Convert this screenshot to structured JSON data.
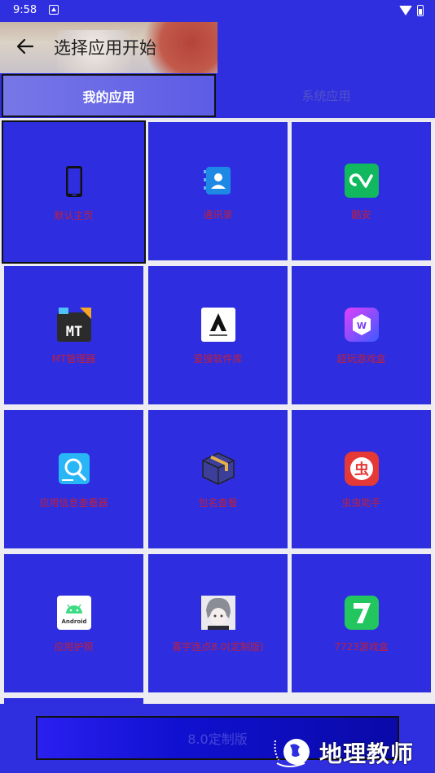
{
  "status_bar": {
    "time": "9:58"
  },
  "header": {
    "title": "选择应用开始"
  },
  "tabs": [
    {
      "label": "我的应用"
    },
    {
      "label": "系统应用"
    }
  ],
  "apps": [
    {
      "label": "默认主页",
      "icon": "phone-icon"
    },
    {
      "label": "通讯录",
      "icon": "contacts-icon"
    },
    {
      "label": "酷安",
      "icon": "coolapk-icon"
    },
    {
      "label": "MT管理器",
      "icon": "mt-manager-icon"
    },
    {
      "label": "爱搜软件库",
      "icon": "aisou-icon"
    },
    {
      "label": "超玩游戏盒",
      "icon": "game-box-icon"
    },
    {
      "label": "应用信息查看器",
      "icon": "app-info-icon"
    },
    {
      "label": "包名查看",
      "icon": "package-icon"
    },
    {
      "label": "虫虫助手",
      "icon": "chongchong-icon"
    },
    {
      "label": "应用护照",
      "icon": "android-icon"
    },
    {
      "label": "喜宇连点8.0(定制版)",
      "icon": "avatar-icon"
    },
    {
      "label": "7723游戏盒",
      "icon": "7723-icon"
    }
  ],
  "bottom_button": {
    "label": "8.0定制版"
  },
  "watermark": {
    "text": "地理教师"
  },
  "colors": {
    "background": "#2f2fe0",
    "label": "#c0203a",
    "tab_selected": "#5a5ae6"
  }
}
